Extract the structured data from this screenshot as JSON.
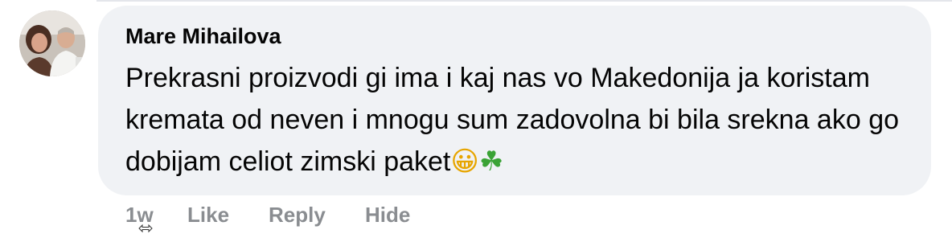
{
  "comment": {
    "author": "Mare Mihailova",
    "text": "Prekrasni proizvodi gi ima i kaj nas vo Makedonija ja koristam kremata od neven i mnogu sum zadovolna bi bila srekna ako go dobijam celiot zimski paket",
    "emojis": [
      "😀",
      "☘"
    ],
    "avatar_icon": "profile-photo"
  },
  "actions": {
    "timestamp": "1w",
    "like": "Like",
    "reply": "Reply",
    "hide": "Hide"
  },
  "colors": {
    "bubble_bg": "#f0f2f5",
    "text": "#050505",
    "secondary_text": "#8a8d91"
  }
}
